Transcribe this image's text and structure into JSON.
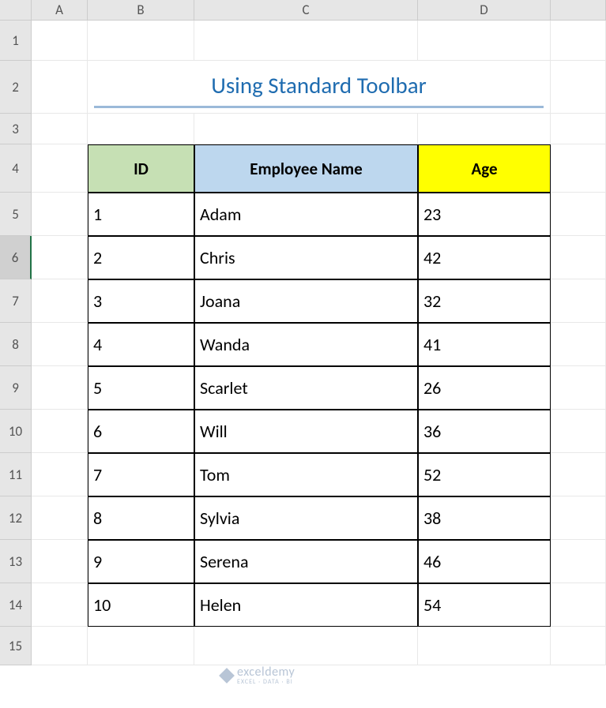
{
  "columns": [
    "A",
    "B",
    "C",
    "D"
  ],
  "rows": [
    "1",
    "2",
    "3",
    "4",
    "5",
    "6",
    "7",
    "8",
    "9",
    "10",
    "11",
    "12",
    "13",
    "14",
    "15"
  ],
  "selected_row": 6,
  "title": "Using Standard Toolbar",
  "headers": {
    "id": "ID",
    "name": "Employee Name",
    "age": "Age"
  },
  "data": [
    {
      "id": "1",
      "name": "Adam",
      "age": "23"
    },
    {
      "id": "2",
      "name": "Chris",
      "age": "42"
    },
    {
      "id": "3",
      "name": "Joana",
      "age": "32"
    },
    {
      "id": "4",
      "name": "Wanda",
      "age": "41"
    },
    {
      "id": "5",
      "name": "Scarlet",
      "age": "26"
    },
    {
      "id": "6",
      "name": "Will",
      "age": "36"
    },
    {
      "id": "7",
      "name": "Tom",
      "age": "52"
    },
    {
      "id": "8",
      "name": "Sylvia",
      "age": "38"
    },
    {
      "id": "9",
      "name": "Serena",
      "age": "46"
    },
    {
      "id": "10",
      "name": "Helen",
      "age": "54"
    }
  ],
  "watermark": {
    "main": "exceldemy",
    "sub": "EXCEL · DATA · BI"
  }
}
